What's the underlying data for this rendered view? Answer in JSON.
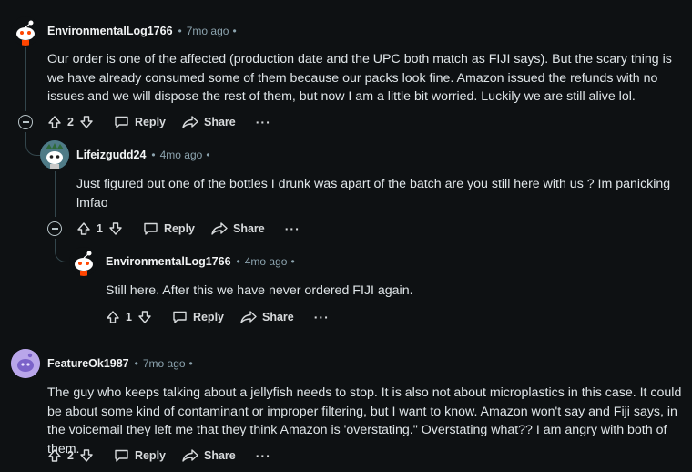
{
  "comments": [
    {
      "author": "EnvironmentalLog1766",
      "age": "7mo ago",
      "body": "Our order is one of the affected (production date and the UPC both match as FIJI says). But the scary thing is we have already consumed some of them because our packs look fine. Amazon issued the refunds with no issues and we will dispose the rest of them, but now I am a little bit worried. Luckily we are still alive lol.",
      "votes": "2",
      "reply_label": "Reply",
      "share_label": "Share",
      "more": "···"
    },
    {
      "author": "Lifeizgudd24",
      "age": "4mo ago",
      "body": "Just figured out one of the bottles I drunk was apart of the batch are you still here with us ? Im panicking lmfao",
      "votes": "1",
      "reply_label": "Reply",
      "share_label": "Share",
      "more": "···"
    },
    {
      "author": "EnvironmentalLog1766",
      "age": "4mo ago",
      "body": "Still here. After this we have never ordered FIJI again.",
      "votes": "1",
      "reply_label": "Reply",
      "share_label": "Share",
      "more": "···"
    },
    {
      "author": "FeatureOk1987",
      "age": "7mo ago",
      "body": "The guy who keeps talking about a jellyfish needs to stop. It is also not about microplastics in this case. It could be about some kind of contaminant or improper filtering, but I want to know. Amazon won't say and Fiji says, in the voicemail they left me that they think Amazon is 'overstating.\" Overstating what?? I am angry with both of them.",
      "votes": "2",
      "reply_label": "Reply",
      "share_label": "Share",
      "more": "···"
    }
  ],
  "separator": "•"
}
